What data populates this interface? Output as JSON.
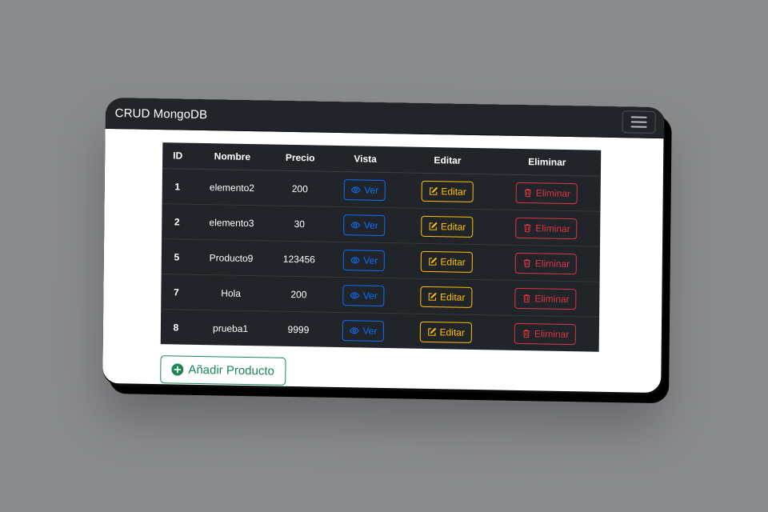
{
  "navbar": {
    "brand": "CRUD MongoDB",
    "toggler_icon": "hamburger-menu-icon"
  },
  "table": {
    "headers": [
      "ID",
      "Nombre",
      "Precio",
      "Vista",
      "Editar",
      "Eliminar"
    ],
    "rows": [
      {
        "id": "1",
        "nombre": "elemento2",
        "precio": "200"
      },
      {
        "id": "2",
        "nombre": "elemento3",
        "precio": "30"
      },
      {
        "id": "5",
        "nombre": "Producto9",
        "precio": "123456"
      },
      {
        "id": "7",
        "nombre": "Hola",
        "precio": "200"
      },
      {
        "id": "8",
        "nombre": "prueba1",
        "precio": "9999"
      }
    ],
    "actions": {
      "ver_label": "Ver",
      "editar_label": "Editar",
      "eliminar_label": "Eliminar",
      "ver_icon": "eye-icon",
      "editar_icon": "pencil-square-icon",
      "eliminar_icon": "trash-icon"
    }
  },
  "add_button": {
    "label": "Añadir Producto",
    "icon": "plus-circle-icon"
  },
  "colors": {
    "navbar_bg": "#212529",
    "primary": "#0d6efd",
    "warning": "#ffc107",
    "danger": "#dc3545",
    "success": "#198754"
  }
}
